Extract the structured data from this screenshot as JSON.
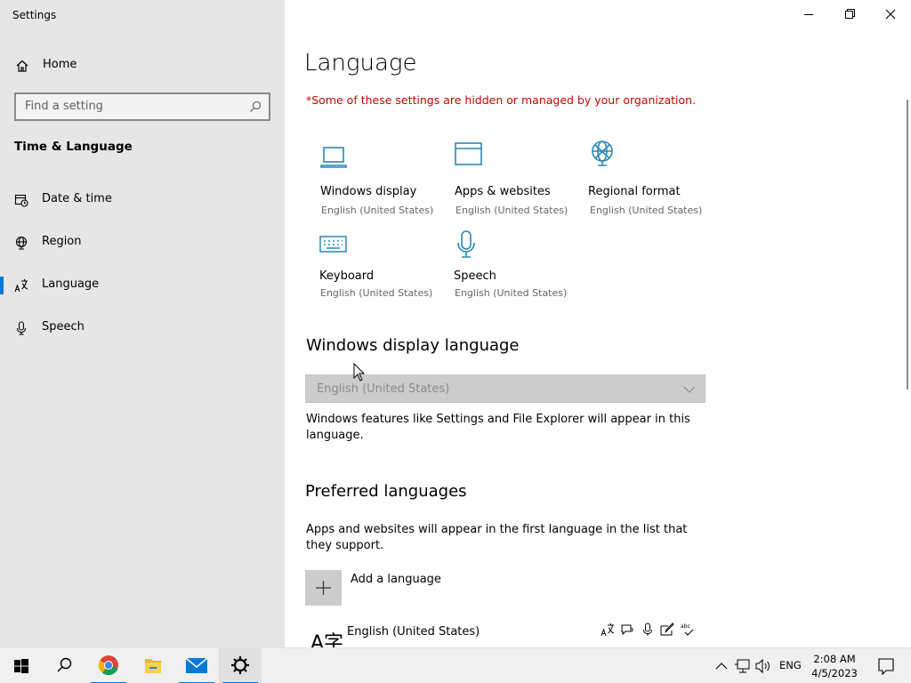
{
  "window": {
    "title": "Settings",
    "controls": {
      "minimize": "minimize",
      "maximize": "restore",
      "close": "close"
    }
  },
  "sidebar": {
    "home_label": "Home",
    "search_placeholder": "Find a setting",
    "section_title": "Time & Language",
    "items": [
      {
        "label": "Date & time",
        "icon": "calendar-clock-icon",
        "selected": false
      },
      {
        "label": "Region",
        "icon": "globe-icon",
        "selected": false
      },
      {
        "label": "Language",
        "icon": "language-icon",
        "selected": true
      },
      {
        "label": "Speech",
        "icon": "microphone-icon",
        "selected": false
      }
    ]
  },
  "main": {
    "title": "Language",
    "warning": "*Some of these settings are hidden or managed by your organization.",
    "tiles": [
      {
        "label": "Windows display",
        "sub": "English (United States)",
        "icon": "laptop-icon"
      },
      {
        "label": "Apps & websites",
        "sub": "English (United States)",
        "icon": "window-icon"
      },
      {
        "label": "Regional format",
        "sub": "English (United States)",
        "icon": "globe-icon"
      },
      {
        "label": "Keyboard",
        "sub": "English (United States)",
        "icon": "keyboard-icon"
      },
      {
        "label": "Speech",
        "sub": "English (United States)",
        "icon": "microphone-icon"
      }
    ],
    "display_language": {
      "heading": "Windows display language",
      "selected": "English (United States)",
      "disabled": true,
      "description": "Windows features like Settings and File Explorer will appear in this language."
    },
    "preferred": {
      "heading": "Preferred languages",
      "description": "Apps and websites will appear in the first language in the list that they support.",
      "add_label": "Add a language",
      "languages": [
        {
          "name": "English (United States)",
          "features": [
            "display-language-icon",
            "text-to-speech-icon",
            "speech-recognition-icon",
            "handwriting-icon",
            "spell-check-icon"
          ]
        }
      ]
    }
  },
  "taskbar": {
    "apps": [
      "start-icon",
      "search-icon",
      "chrome-icon",
      "file-explorer-icon",
      "mail-icon",
      "settings-icon"
    ],
    "active_app": "settings-icon",
    "tray": {
      "input_language": "ENG",
      "time": "2:08 AM",
      "date": "4/5/2023"
    }
  },
  "colors": {
    "accent": "#0078d7",
    "warning": "#c50500",
    "icon_teal": "#2b87b4"
  }
}
